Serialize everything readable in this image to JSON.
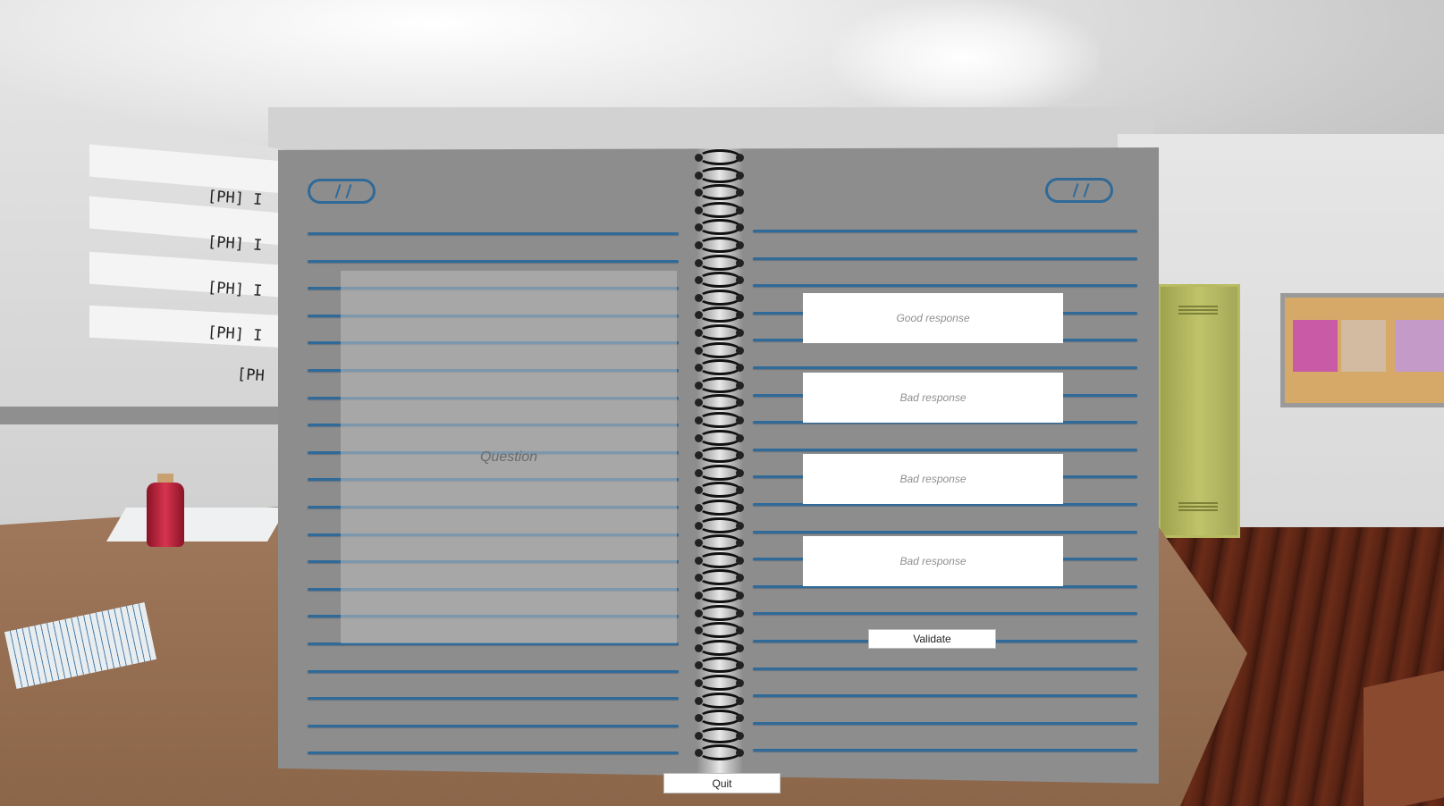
{
  "background": {
    "placeholder_items": [
      "[PH] I",
      "[PH] I",
      "[PH] I",
      "[PH] I",
      "[PH"
    ],
    "colors": {
      "table": "#a0785c",
      "floor": "#5a2414",
      "locker": "#b8bb60",
      "corkboard": "#d7a968",
      "potion": "#d6344e",
      "notes": [
        "#c85aa6",
        "#d2bba0",
        "#c49ac8"
      ]
    }
  },
  "notebook": {
    "colors": {
      "page": "#8d8d8d",
      "rule_line": "#2f6a98"
    },
    "question": {
      "text": "Question"
    },
    "answers": [
      {
        "label": "Good response"
      },
      {
        "label": "Bad response"
      },
      {
        "label": "Bad response"
      },
      {
        "label": "Bad response"
      }
    ],
    "validate_label": "Validate"
  },
  "quit_label": "Quit"
}
